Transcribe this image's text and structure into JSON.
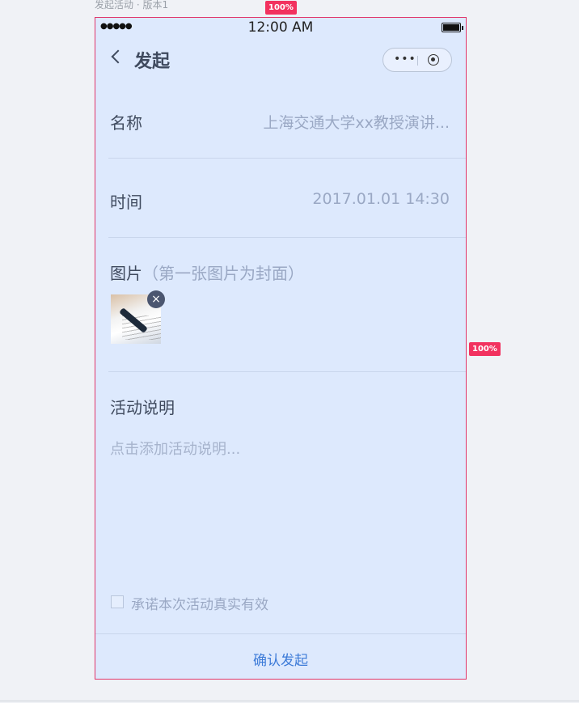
{
  "artboard": {
    "label": "发起活动 · 版本1",
    "width_badge": "100%",
    "height_badge": "100%"
  },
  "status_bar": {
    "signal": "●●●●●",
    "time": "12:00 AM",
    "battery": "full"
  },
  "nav": {
    "back_icon": "chevron-left-icon",
    "title": "发起",
    "capsule_more": "•••",
    "capsule_close_icon": "target-icon"
  },
  "form": {
    "name_label": "名称",
    "name_value": "上海交通大学xx教授演讲...",
    "time_label": "时间",
    "time_value": "2017.01.01  14:30",
    "images_label": "图片",
    "images_hint": "（第一张图片为封面）",
    "image_remove": "×",
    "description_label": "活动说明",
    "description_placeholder": "点击添加活动说明...",
    "promise_label": "承诺本次活动真实有效",
    "promise_checked": false
  },
  "footer": {
    "confirm_label": "确认发起"
  },
  "colors": {
    "background": "#dde9fd",
    "accent": "#3d7bd8",
    "text": "#3f4a5e",
    "muted": "#9aa8c4"
  }
}
